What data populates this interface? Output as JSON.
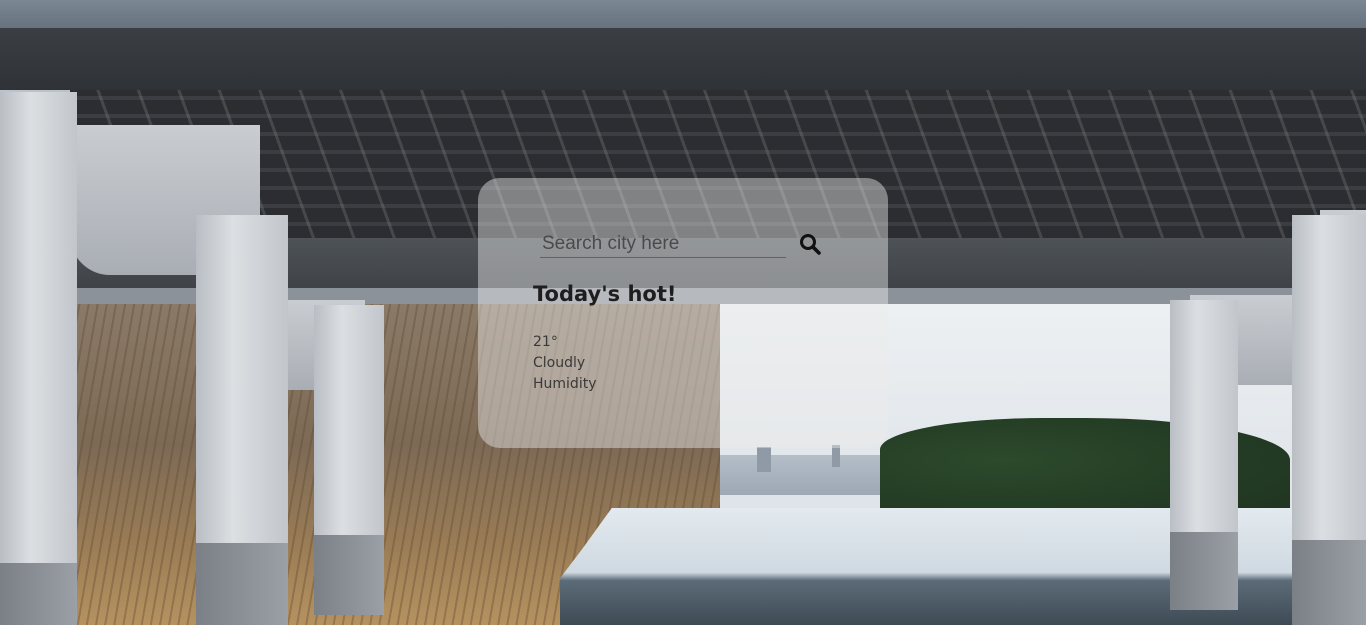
{
  "search": {
    "placeholder": "Search city here",
    "value": "",
    "icon": "search-icon"
  },
  "weather": {
    "headline": "Today's hot!",
    "temperature": "21°",
    "condition": "Cloudly",
    "humidity_label": "Humidity"
  },
  "colors": {
    "card_background": "#ebebeb",
    "input_underline": "#b0413e",
    "text_dark": "#1e1e1e"
  }
}
